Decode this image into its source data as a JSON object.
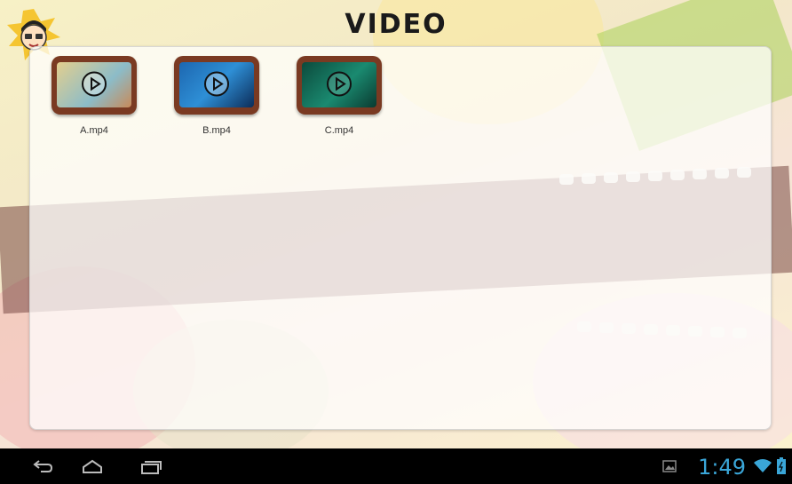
{
  "app": {
    "title": "VIDEO"
  },
  "files": [
    {
      "name": "A.mp4",
      "thumb_color": "#d9c48a",
      "thumb_accent": "#5aa0b8"
    },
    {
      "name": "B.mp4",
      "thumb_color": "#1f6fb3",
      "thumb_accent": "#ffffff"
    },
    {
      "name": "C.mp4",
      "thumb_color": "#0f5a4a",
      "thumb_accent": "#1a8a70"
    }
  ],
  "status_bar": {
    "time": "1:49",
    "icons": [
      "gallery-icon",
      "wifi-icon",
      "battery-icon"
    ]
  },
  "nav_bar": {
    "icons": [
      "back-icon",
      "home-icon",
      "recent-apps-icon"
    ]
  },
  "colors": {
    "clock": "#3aa6d8",
    "navbar": "#000000"
  }
}
